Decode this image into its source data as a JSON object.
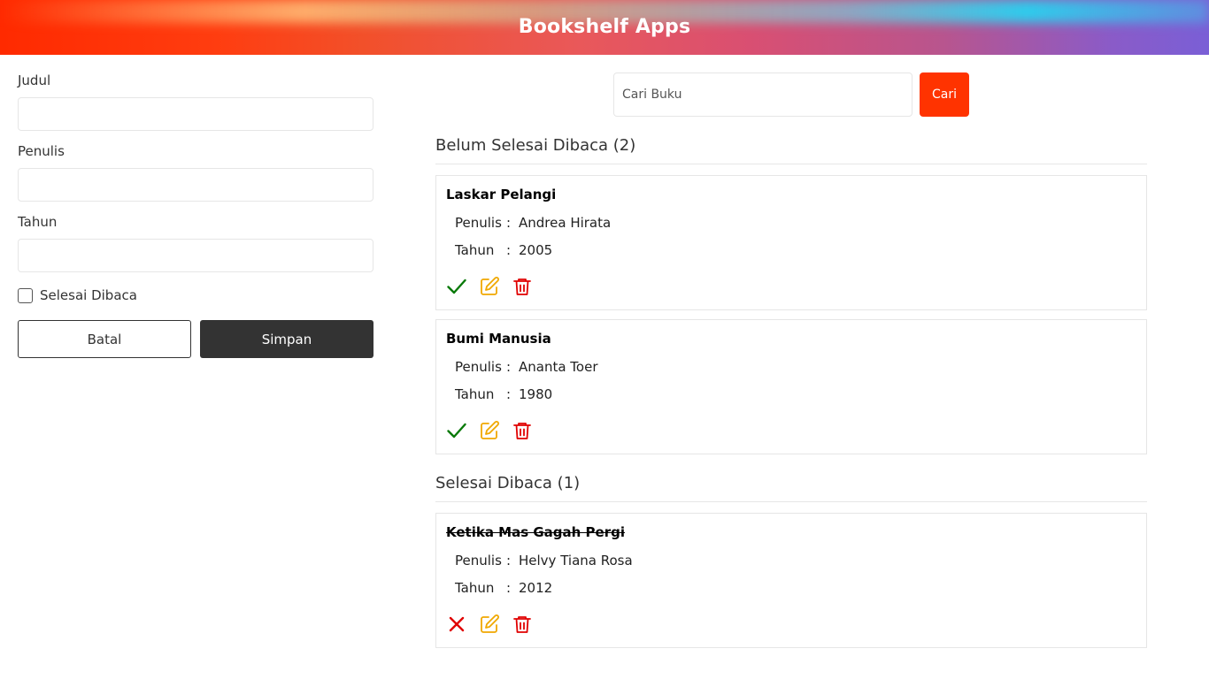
{
  "app": {
    "title": "Bookshelf Apps"
  },
  "form": {
    "title_label": "Judul",
    "title_value": "",
    "author_label": "Penulis",
    "author_value": "",
    "year_label": "Tahun",
    "year_value": "",
    "finished_label": "Selesai Dibaca",
    "finished_checked": false,
    "cancel_label": "Batal",
    "save_label": "Simpan"
  },
  "search": {
    "placeholder": "Cari Buku",
    "value": "",
    "button_label": "Cari",
    "button_color": "#ff3300"
  },
  "unread": {
    "heading": "Belum Selesai Dibaca (2)",
    "books": [
      {
        "title": "Laskar Pelangi",
        "author_key": "Penulis",
        "author": "Andrea Hirata",
        "year_key": "Tahun",
        "year": "2005"
      },
      {
        "title": "Bumi Manusia",
        "author_key": "Penulis",
        "author": "Ananta Toer",
        "year_key": "Tahun",
        "year": "1980"
      }
    ]
  },
  "read": {
    "heading": "Selesai Dibaca (1)",
    "books": [
      {
        "title": "Ketika Mas Gagah Pergi",
        "author_key": "Penulis",
        "author": "Helvy Tiana Rosa",
        "year_key": "Tahun",
        "year": "2012"
      }
    ]
  },
  "separator": ":",
  "icons": {
    "mark_done": "check-icon",
    "mark_undone": "x-icon",
    "edit": "edit-icon",
    "delete": "trash-icon"
  },
  "colors": {
    "done": "#0a7a0a",
    "undone": "#e00000",
    "edit": "#f0a800",
    "delete": "#e00000",
    "header_start": "#ff2a00",
    "header_end": "#7a5fd6"
  }
}
